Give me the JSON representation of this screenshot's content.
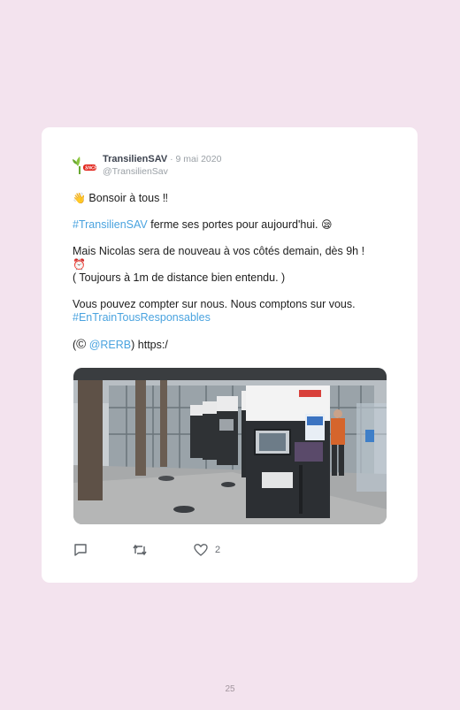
{
  "tweet": {
    "display_name": "TransilienSAV",
    "separator": " · ",
    "date": "9 mai 2020",
    "handle": "@TransilienSav",
    "lines": {
      "greeting_emoji": "👋",
      "greeting": " Bonsoir à tous ‼",
      "hashtag1": "#TransilienSAV",
      "closed_text": " ferme ses portes pour aujourd'hui. ",
      "closed_emoji": "😪",
      "tomorrow": "Mais Nicolas sera de nouveau à vos côtés demain, dès 9h !",
      "clock_emoji": "⏰",
      "distance": "( Toujours à 1m de distance bien entendu. )",
      "count_on_us": "Vous pouvez compter sur nous. Nous comptons sur vous.",
      "hashtag2": "#EnTrainTousResponsables",
      "credit_open": "(",
      "copyright": "©",
      "credit_space": " ",
      "mention": "@RERB",
      "credit_close": ") https:/"
    },
    "photo_alt_icon": "ticket-machines-photo",
    "actions": {
      "reply_icon": "reply-icon",
      "retweet_icon": "retweet-icon",
      "like_icon": "heart-icon",
      "like_count": "2"
    },
    "colors": {
      "link": "#4aa3df",
      "background": "#f3e3ee",
      "card": "#ffffff"
    }
  },
  "page": {
    "number": "25"
  }
}
